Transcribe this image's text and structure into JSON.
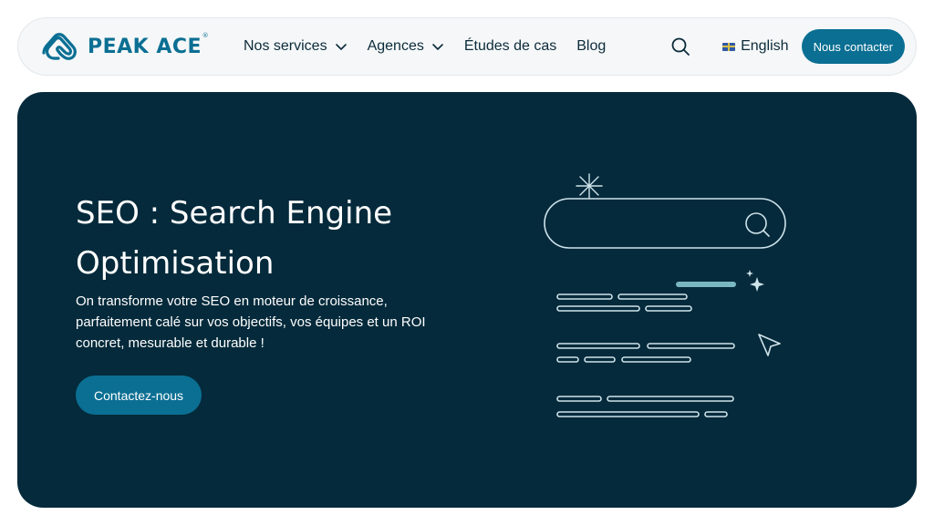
{
  "header": {
    "logo_text": "PEAK ACE",
    "logo_mark": "®",
    "nav": [
      {
        "label": "Nos services",
        "has_dropdown": true
      },
      {
        "label": "Agences",
        "has_dropdown": true
      },
      {
        "label": "Études de cas",
        "has_dropdown": false
      },
      {
        "label": "Blog",
        "has_dropdown": false
      }
    ],
    "language": "English",
    "contact_label": "Nous contacter"
  },
  "hero": {
    "title_line1": "SEO : Search Engine",
    "title_line2": "Optimisation",
    "subtitle_line1": "On transforme votre SEO en moteur de croissance,",
    "subtitle_line2": "parfaitement calé sur vos objectifs, vos équipes et un ROI",
    "subtitle_line3": "concret, mesurable et durable !",
    "cta_label": "Contactez-nous"
  },
  "colors": {
    "brand": "#0b6f93",
    "hero_bg": "#042a3b",
    "nav_bg": "#f5f7f8",
    "highlight_yellow": "#e8c23a",
    "highlight_teal": "#7bb7c0"
  },
  "icons": {
    "logo": "mountain-logo-icon",
    "search": "search-icon",
    "dropdown": "chevron-down-icon",
    "flag": "uk-flag-icon"
  }
}
